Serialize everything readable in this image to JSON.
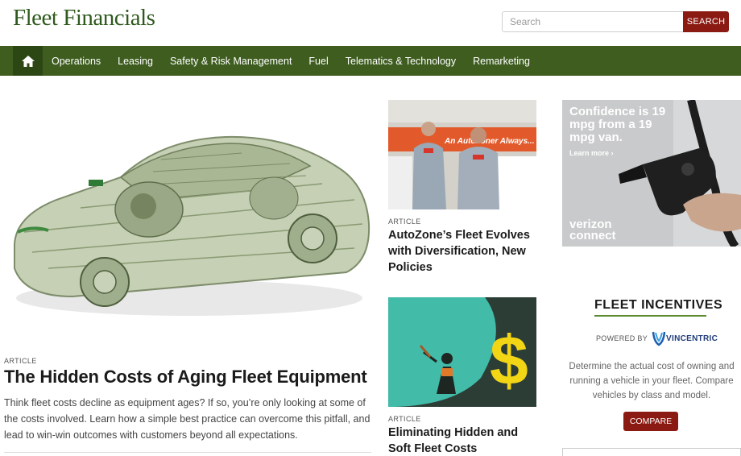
{
  "header": {
    "logo": "Fleet Financials",
    "search_placeholder": "Search",
    "search_button": "SEARCH"
  },
  "nav": {
    "home_icon": "home-icon",
    "items": [
      "Operations",
      "Leasing",
      "Safety & Risk Management",
      "Fuel",
      "Telematics & Technology",
      "Remarketing"
    ]
  },
  "hero": {
    "label": "ARTICLE",
    "title": "The Hidden Costs of Aging Fleet Equipment",
    "description": "Think fleet costs decline as equipment ages? If so, you’re only looking at some of the costs involved. Learn how a simple best practice can overcome this pitfall, and lead to win-win outcomes with customers beyond all expectations."
  },
  "cards": [
    {
      "label": "ARTICLE",
      "title": "AutoZone’s Fleet Evolves with Diversification, New Policies",
      "sign_text": "An AutoZoner Always..."
    },
    {
      "label": "ARTICLE",
      "title": "Eliminating Hidden and Soft Fleet Costs",
      "symbol": "$"
    }
  ],
  "ad": {
    "headline": "Confidence is 19 mpg from a 19 mpg van.",
    "link": "Learn more",
    "brand_line1": "verizon",
    "brand_line2": "connect"
  },
  "incentives": {
    "title": "FLEET INCENTIVES",
    "powered_by": "POWERED BY",
    "partner": "VINCENTRIC",
    "description": "Determine the actual cost of owning and running a vehicle in your fleet. Compare vehicles by class and model.",
    "button": "COMPARE"
  },
  "colors": {
    "brand_green": "#3e5d1f",
    "accent_red": "#8b1a12"
  }
}
